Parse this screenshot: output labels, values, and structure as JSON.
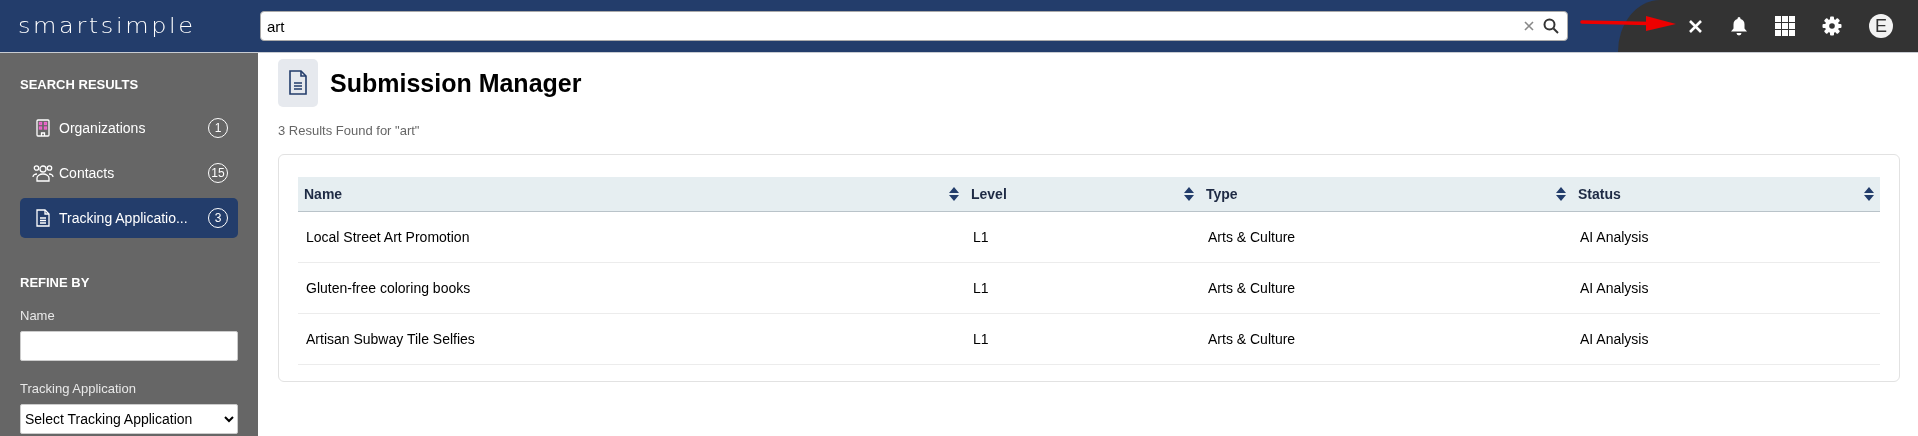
{
  "header": {
    "logo": "smartsimple",
    "search": {
      "value": "art"
    },
    "avatar_initial": "E"
  },
  "sidebar": {
    "section_title": "SEARCH RESULTS",
    "items": [
      {
        "kind": "organization",
        "label": "Organizations",
        "count": "1",
        "selected": false
      },
      {
        "kind": "contacts",
        "label": "Contacts",
        "count": "15",
        "selected": false
      },
      {
        "kind": "document",
        "label": "Tracking Applicatio...",
        "count": "3",
        "selected": true
      }
    ],
    "refine_title": "REFINE BY",
    "filters": [
      {
        "kind": "text",
        "label": "Name"
      },
      {
        "kind": "select",
        "label": "Tracking Application",
        "value": "Select Tracking Application"
      }
    ]
  },
  "main": {
    "title": "Submission Manager",
    "result_summary": "3 Results Found for \"art\"",
    "table": {
      "columns": [
        "Name",
        "Level",
        "Type",
        "Status"
      ],
      "rows": [
        [
          "Local Street Art Promotion",
          "L1",
          "Arts & Culture",
          "AI Analysis"
        ],
        [
          "Gluten-free coloring books",
          "L1",
          "Arts & Culture",
          "AI Analysis"
        ],
        [
          "Artisan Subway Tile Selfies",
          "L1",
          "Arts & Culture",
          "AI Analysis"
        ]
      ]
    }
  }
}
